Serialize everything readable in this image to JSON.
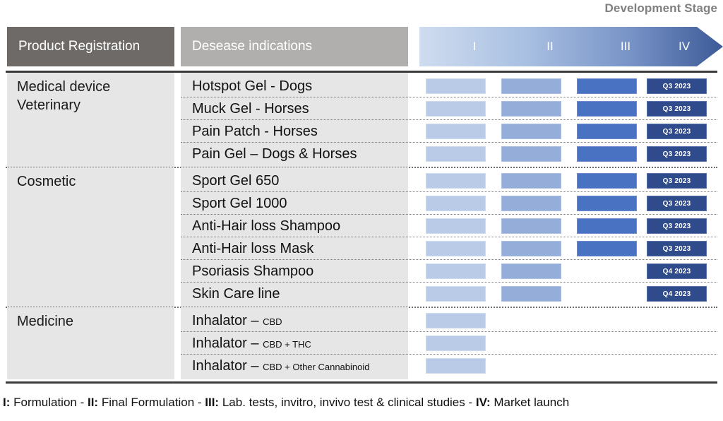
{
  "title": "Development Stage",
  "header": {
    "product_registration": "Product Registration",
    "disease_indications": "Desease indications",
    "stages": [
      "I",
      "II",
      "III",
      "IV"
    ]
  },
  "legend": {
    "parts": [
      {
        "tag": "I:",
        "text": " Formulation"
      },
      {
        "tag": "II:",
        "text": " Final Formulation"
      },
      {
        "tag": "III:",
        "text": " Lab. tests, invitro, invivo test & clinical studies"
      },
      {
        "tag": "IV:",
        "text": " Market launch"
      }
    ],
    "separator": " - ",
    "full": "I: Formulation - II: Final Formulation - III: Lab. tests, invitro, invivo test & clinical studies - IV: Market launch"
  },
  "colors": {
    "stage1": "#b9cbe7",
    "stage2": "#95aed9",
    "stage3": "#4a72c2",
    "stage4": "#2f4b8b",
    "header_dark": "#6e6a67",
    "header_light": "#b0afad",
    "row_background": "#e6e6e6",
    "title_gray": "#808080"
  },
  "chart_data": {
    "type": "table",
    "title": "Development Stage",
    "stage_columns": [
      "I",
      "II",
      "III",
      "IV"
    ],
    "groups": [
      {
        "category": "Medical device\nVeterinary",
        "category_line1": "Medical device",
        "category_line2": "Veterinary",
        "rows": [
          {
            "indication": "Hotspot Gel - Dogs",
            "stages": [
              true,
              true,
              true,
              true
            ],
            "stage4_label": "Q3 2023"
          },
          {
            "indication": "Muck Gel - Horses",
            "stages": [
              true,
              true,
              true,
              true
            ],
            "stage4_label": "Q3 2023"
          },
          {
            "indication": "Pain Patch - Horses",
            "stages": [
              true,
              true,
              true,
              true
            ],
            "stage4_label": "Q3 2023"
          },
          {
            "indication": "Pain Gel – Dogs & Horses",
            "stages": [
              true,
              true,
              true,
              true
            ],
            "stage4_label": "Q3 2023"
          }
        ]
      },
      {
        "category": "Cosmetic",
        "category_line1": "Cosmetic",
        "category_line2": "",
        "rows": [
          {
            "indication": "Sport Gel 650",
            "stages": [
              true,
              true,
              true,
              true
            ],
            "stage4_label": "Q3 2023"
          },
          {
            "indication": "Sport Gel 1000",
            "stages": [
              true,
              true,
              true,
              true
            ],
            "stage4_label": "Q3 2023"
          },
          {
            "indication": "Anti-Hair loss Shampoo",
            "stages": [
              true,
              true,
              true,
              true
            ],
            "stage4_label": "Q3 2023"
          },
          {
            "indication": "Anti-Hair loss Mask",
            "stages": [
              true,
              true,
              true,
              true
            ],
            "stage4_label": "Q3 2023"
          },
          {
            "indication": "Psoriasis Shampoo",
            "stages": [
              true,
              true,
              false,
              true
            ],
            "stage4_label": "Q4 2023"
          },
          {
            "indication": "Skin Care line",
            "stages": [
              true,
              true,
              false,
              true
            ],
            "stage4_label": "Q4 2023"
          }
        ]
      },
      {
        "category": "Medicine",
        "category_line1": "Medicine",
        "category_line2": "",
        "rows": [
          {
            "indication": "Inhalator – ",
            "indication_sub": "CBD",
            "stages": [
              true,
              false,
              false,
              false
            ],
            "stage4_label": ""
          },
          {
            "indication": "Inhalator – ",
            "indication_sub": "CBD + THC",
            "stages": [
              true,
              false,
              false,
              false
            ],
            "stage4_label": ""
          },
          {
            "indication": "Inhalator – ",
            "indication_sub": "CBD + Other Cannabinoid",
            "stages": [
              true,
              false,
              false,
              false
            ],
            "stage4_label": ""
          }
        ]
      }
    ]
  }
}
